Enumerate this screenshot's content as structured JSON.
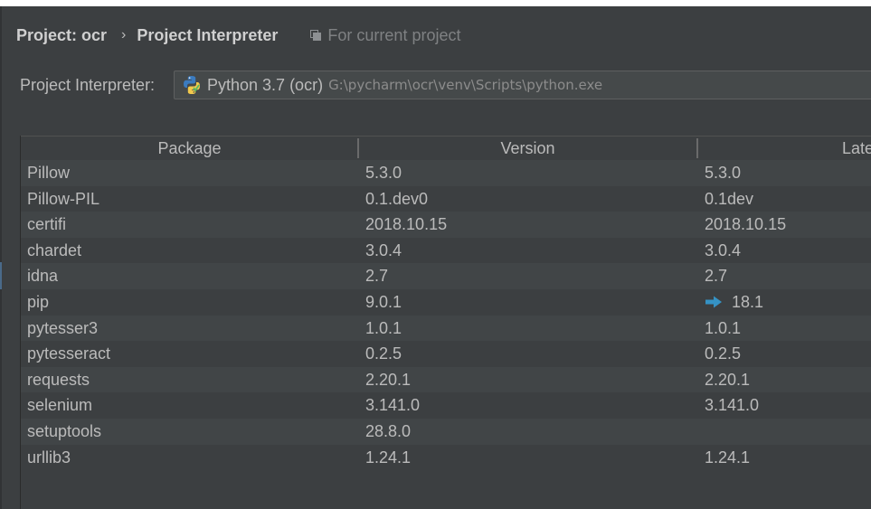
{
  "breadcrumb": {
    "project": "Project: ocr",
    "separator": "›",
    "page": "Project Interpreter",
    "scope_icon": "copy-icon",
    "scope_label": "For current project"
  },
  "interpreter": {
    "label": "Project Interpreter:",
    "icon": "python-icon",
    "name": "Python 3.7 (ocr)",
    "path": "G:\\pycharm\\ocr\\venv\\Scripts\\python.exe"
  },
  "table": {
    "columns": [
      "Package",
      "Version",
      "Late"
    ],
    "rows": [
      {
        "package": "Pillow",
        "version": "5.3.0",
        "latest": "5.3.0"
      },
      {
        "package": "Pillow-PIL",
        "version": "0.1.dev0",
        "latest": "0.1dev"
      },
      {
        "package": "certifi",
        "version": "2018.10.15",
        "latest": "2018.10.15"
      },
      {
        "package": "chardet",
        "version": "3.0.4",
        "latest": "3.0.4"
      },
      {
        "package": "idna",
        "version": "2.7",
        "latest": "2.7"
      },
      {
        "package": "pip",
        "version": "9.0.1",
        "latest": "18.1",
        "upgrade_icon": "arrow-right-icon"
      },
      {
        "package": "pytesser3",
        "version": "1.0.1",
        "latest": "1.0.1"
      },
      {
        "package": "pytesseract",
        "version": "0.2.5",
        "latest": "0.2.5"
      },
      {
        "package": "requests",
        "version": "2.20.1",
        "latest": "2.20.1"
      },
      {
        "package": "selenium",
        "version": "3.141.0",
        "latest": "3.141.0"
      },
      {
        "package": "setuptools",
        "version": "28.8.0",
        "latest": ""
      },
      {
        "package": "urllib3",
        "version": "1.24.1",
        "latest": "1.24.1"
      }
    ]
  },
  "colors": {
    "background": "#3c3f41",
    "text": "#bbbbbb",
    "upgrade_arrow": "#3592c4"
  }
}
